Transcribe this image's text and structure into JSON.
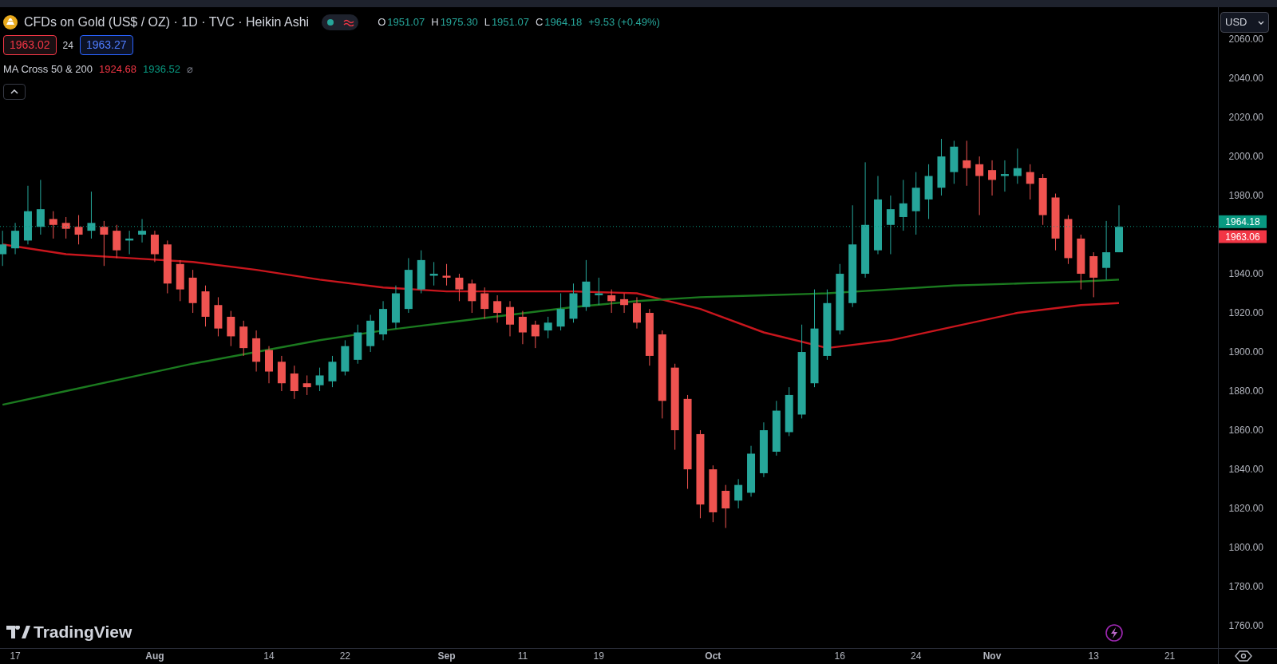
{
  "header": {
    "symbol_title": "CFDs on Gold (US$ / OZ) · 1D · TVC · Heikin Ashi",
    "ohlc": [
      {
        "label": "O",
        "value": "1951.07"
      },
      {
        "label": "H",
        "value": "1975.30"
      },
      {
        "label": "L",
        "value": "1951.07"
      },
      {
        "label": "C",
        "value": "1964.18"
      }
    ],
    "change": "+9.53 (+0.49%)",
    "sell_price": "1963.02",
    "spread": "24",
    "buy_price": "1963.27"
  },
  "indicator": {
    "name": "MA Cross 50 & 200",
    "values": [
      {
        "text": "1924.68",
        "color": "#f23645"
      },
      {
        "text": "1936.52",
        "color": "#089981"
      }
    ],
    "hidden_symbol": "⌀"
  },
  "currency": "USD",
  "logo_text": "TradingView",
  "chart": {
    "price_axis_labels": [
      "2060.00",
      "2040.00",
      "2020.00",
      "2000.00",
      "1980.00",
      "1940.00",
      "1920.00",
      "1900.00",
      "1880.00",
      "1860.00",
      "1840.00",
      "1820.00",
      "1800.00",
      "1780.00",
      "1760.00"
    ],
    "time_axis_labels": [
      {
        "text": "17",
        "kind": "day"
      },
      {
        "text": "Aug",
        "kind": "month"
      },
      {
        "text": "14",
        "kind": "day"
      },
      {
        "text": "22",
        "kind": "day"
      },
      {
        "text": "Sep",
        "kind": "month"
      },
      {
        "text": "11",
        "kind": "day"
      },
      {
        "text": "19",
        "kind": "day"
      },
      {
        "text": "Oct",
        "kind": "month"
      },
      {
        "text": "16",
        "kind": "day"
      },
      {
        "text": "24",
        "kind": "day"
      },
      {
        "text": "Nov",
        "kind": "month"
      },
      {
        "text": "13",
        "kind": "day"
      },
      {
        "text": "21",
        "kind": "day"
      }
    ],
    "price_labels": [
      {
        "text": "1964.18",
        "color": "#089981"
      },
      {
        "text": "1963.06",
        "color": "#f23645"
      }
    ]
  }
}
